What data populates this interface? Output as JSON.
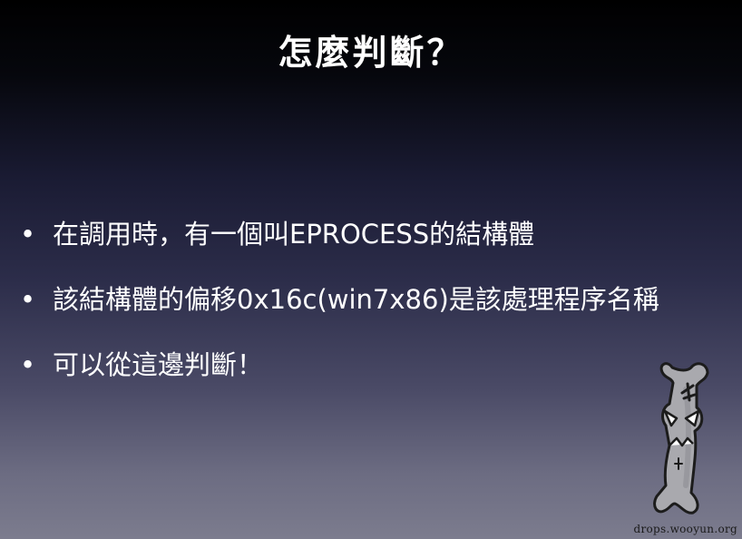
{
  "slide": {
    "title": "怎麼判斷？",
    "bullet_symbol": "•",
    "bullets": [
      "在調用時，有一個叫EPROCESS的結構體",
      "該結構體的偏移0x16c(win7x86)是該處理程序名稱",
      "可以從這邊判斷！"
    ]
  },
  "mascot": {
    "icon": "bone-character-icon"
  },
  "watermark": {
    "text": "drops.wooyun.org"
  },
  "colors": {
    "background_top": "#000000",
    "background_bottom": "#7c7c8e",
    "text": "#ffffff"
  }
}
